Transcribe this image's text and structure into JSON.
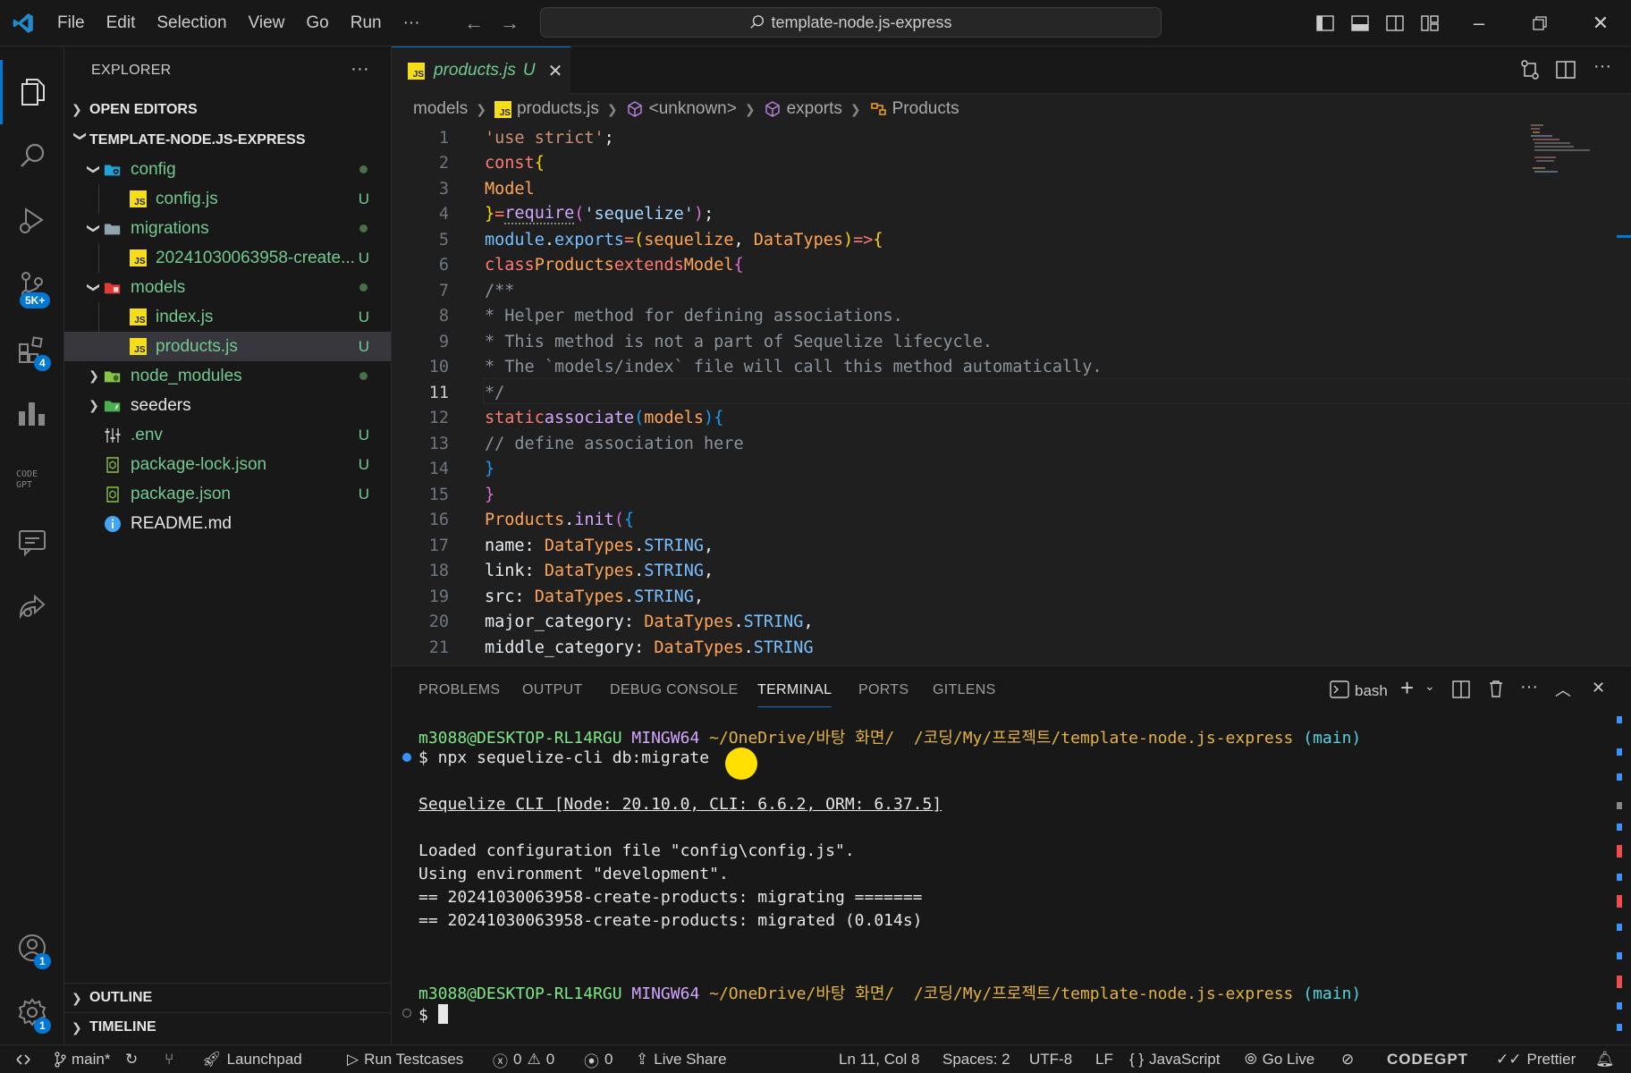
{
  "titlebar": {
    "menu": [
      "File",
      "Edit",
      "Selection",
      "View",
      "Go",
      "Run",
      "···"
    ],
    "search": "template-node.js-express"
  },
  "activity": {
    "scm_badge": "5K+",
    "extensions_badge": "4",
    "accounts_badge": "1",
    "settings_badge": "1"
  },
  "sidebar": {
    "title": "EXPLORER",
    "more": "···",
    "open_editors": "OPEN EDITORS",
    "project": "TEMPLATE-NODE.JS-EXPRESS",
    "tree": [
      {
        "label": "config",
        "kind": "folder-open",
        "icon": "config-folder-icon",
        "status": "dot"
      },
      {
        "label": "config.js",
        "kind": "js",
        "status": "U"
      },
      {
        "label": "migrations",
        "kind": "folder-open",
        "icon": "folder-icon",
        "status": "dot"
      },
      {
        "label": "20241030063958-create...",
        "kind": "js",
        "status": "U"
      },
      {
        "label": "models",
        "kind": "folder-open",
        "icon": "models-folder-icon",
        "status": "dot"
      },
      {
        "label": "index.js",
        "kind": "js",
        "status": "U"
      },
      {
        "label": "products.js",
        "kind": "js",
        "status": "U",
        "selected": true
      },
      {
        "label": "node_modules",
        "kind": "folder",
        "icon": "node-folder-icon",
        "status": "dot"
      },
      {
        "label": "seeders",
        "kind": "folder",
        "icon": "seeders-folder-icon",
        "status": ""
      },
      {
        "label": ".env",
        "kind": "env",
        "status": "U"
      },
      {
        "label": "package-lock.json",
        "kind": "json",
        "status": "U"
      },
      {
        "label": "package.json",
        "kind": "json",
        "status": "U"
      },
      {
        "label": "README.md",
        "kind": "info",
        "status": ""
      }
    ],
    "outline": "OUTLINE",
    "timeline": "TIMELINE"
  },
  "editor": {
    "tab": {
      "name": "products.js",
      "status": "U"
    },
    "breadcrumb": [
      "models",
      "products.js",
      "<unknown>",
      "exports",
      "Products"
    ],
    "current_line": 11
  },
  "panel": {
    "tabs": [
      "PROBLEMS",
      "OUTPUT",
      "DEBUG CONSOLE",
      "TERMINAL",
      "PORTS",
      "GITLENS"
    ],
    "active_tab": "TERMINAL",
    "shell": "bash",
    "terminal": {
      "prompt_user": "m3088@DESKTOP-RL14RGU",
      "prompt_env": "MINGW64",
      "prompt_path": "~/OneDrive/바탕 화면/  /코딩/My/프로젝트/template-node.js-express",
      "prompt_branch": "(main)",
      "command": "$ npx sequelize-cli db:migrate",
      "cli_line": "Sequelize CLI [Node: 20.10.0, CLI: 6.6.2, ORM: 6.37.5]",
      "out1": "Loaded configuration file \"config\\config.js\".",
      "out2": "Using environment \"development\".",
      "out3": "== 20241030063958-create-products: migrating =======",
      "out4": "== 20241030063958-create-products: migrated (0.014s)",
      "prompt2": "$"
    }
  },
  "statusbar": {
    "branch": "main*",
    "launchpad": "Launchpad",
    "testcases": "Run Testcases",
    "errors": "0",
    "warnings": "0",
    "ports": "0",
    "liveshare": "Live Share",
    "position": "Ln 11, Col 8",
    "spaces": "Spaces: 2",
    "encoding": "UTF-8",
    "eol": "LF",
    "language": "JavaScript",
    "golive": "Go Live",
    "codegpt": "CODEGPT",
    "prettier": "Prettier"
  },
  "colors": {
    "accent": "#0078d4",
    "untracked": "#73c991",
    "bg": "#1f1f1f"
  }
}
